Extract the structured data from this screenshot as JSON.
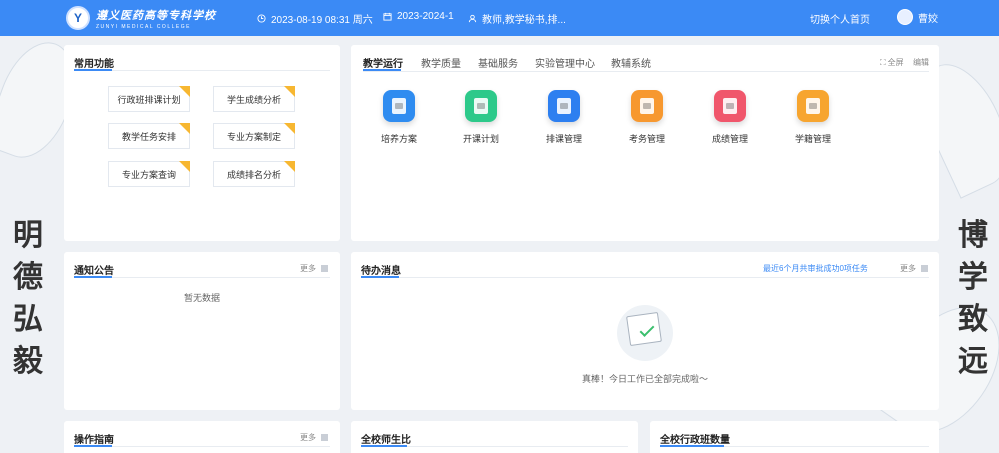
{
  "header": {
    "logo_cn": "遵义医药高等专科学校",
    "logo_en": "ZUNYI MEDICAL COLLEGE",
    "datetime": "2023-08-19 08:31 周六",
    "term": "2023-2024-1",
    "role": "教师,教学秘书,排...",
    "switch_home": "切换个人首页",
    "username": "曹姣"
  },
  "background": {
    "left_motto": [
      "明",
      "德",
      "弘",
      "毅"
    ],
    "right_motto": [
      "博",
      "学",
      "致",
      "远"
    ]
  },
  "quick_functions": {
    "title": "常用功能",
    "items": [
      "行政班排课计划",
      "学生成绩分析",
      "教学任务安排",
      "专业方案制定",
      "专业方案查询",
      "成绩排名分析"
    ]
  },
  "teaching": {
    "tabs": [
      "教学运行",
      "教学质量",
      "基础服务",
      "实验管理中心",
      "教辅系统"
    ],
    "fullscreen": "全屏",
    "edit": "编辑",
    "apps": [
      {
        "label": "培养方案",
        "icon": "training-plan-icon",
        "color": "#2f8cf0"
      },
      {
        "label": "开课计划",
        "icon": "course-plan-icon",
        "color": "#2dc98a"
      },
      {
        "label": "排课管理",
        "icon": "schedule-icon",
        "color": "#2d7ff0"
      },
      {
        "label": "考务管理",
        "icon": "exam-icon",
        "color": "#f7982f"
      },
      {
        "label": "成绩管理",
        "icon": "grade-icon",
        "color": "#f0566b"
      },
      {
        "label": "学籍管理",
        "icon": "student-record-icon",
        "color": "#f7a52f"
      }
    ]
  },
  "notice": {
    "title": "通知公告",
    "more": "更多",
    "empty": "暂无数据"
  },
  "todo": {
    "title": "待办消息",
    "link": "最近6个月共审批成功0项任务",
    "more": "更多",
    "empty": "真棒！今日工作已全部完成啦～"
  },
  "guide": {
    "title": "操作指南",
    "more": "更多"
  },
  "teacher_student_ratio": {
    "title": "全校师生比"
  },
  "admin_class_count": {
    "title": "全校行政班数量"
  }
}
